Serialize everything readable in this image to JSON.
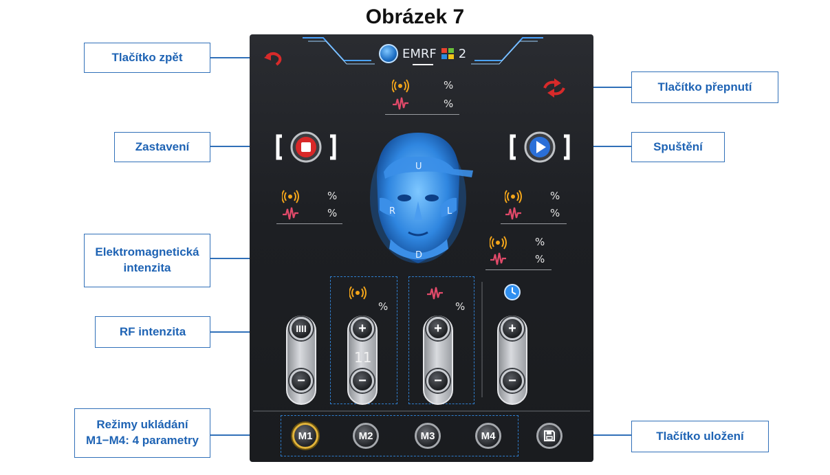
{
  "figure_title": "Obrázek 7",
  "callouts": {
    "back": "Tlačítko zpět",
    "switch": "Tlačítko přepnutí",
    "stop": "Zastavení",
    "start": "Spuštění",
    "em_intensity_line1": "Elektromagnetická",
    "em_intensity_line2": "intenzita",
    "rf_intensity": "RF intenzita",
    "memory_line1": "Režimy ukládání",
    "memory_line2": "M1−M4: 4 parametry",
    "save": "Tlačítko uložení"
  },
  "app": {
    "brand_name": "EMRF",
    "brand_number": "2",
    "percent_unit": "%",
    "face_zones": {
      "up": "U",
      "right": "R",
      "left": "L",
      "down": "D"
    },
    "em_value": "11",
    "rf_level_symbol": "IIII",
    "plus": "+",
    "minus": "−",
    "memories": [
      "M1",
      "M2",
      "M3",
      "M4"
    ],
    "colors": {
      "em_icon": "#f3a51a",
      "rf_icon": "#e24a6a",
      "back_arrow": "#d72a2a",
      "stop": "#d82828",
      "start": "#2a6fd8",
      "accent_blue": "#2f7fd0"
    }
  }
}
